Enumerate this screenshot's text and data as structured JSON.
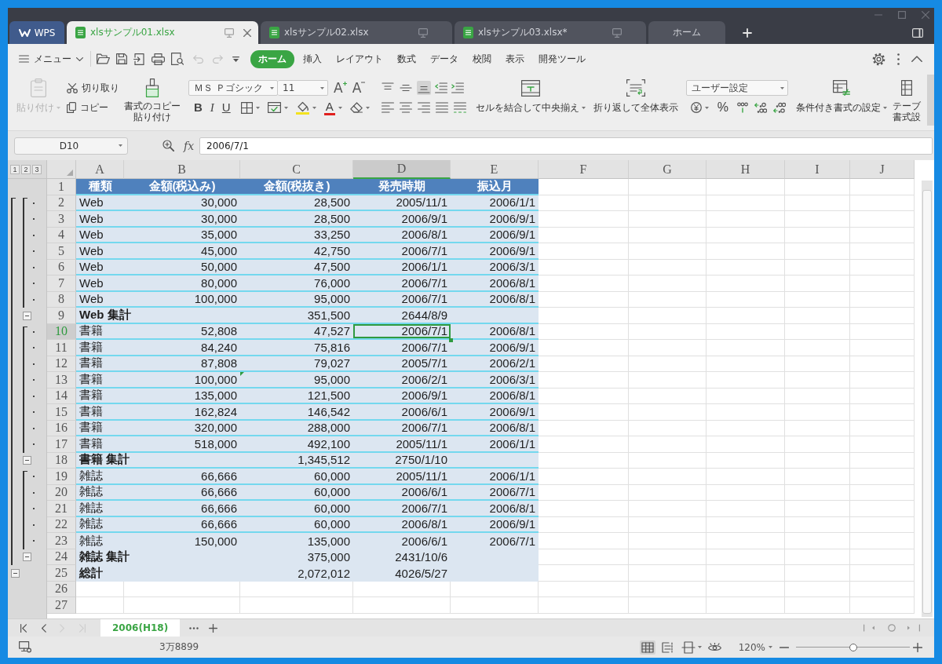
{
  "window": {
    "app_tab": {
      "label": "WPS"
    },
    "tabs": [
      {
        "kind": "file",
        "label": "xlsサンプル01.xlsx",
        "selected": true
      },
      {
        "kind": "file",
        "label": "xlsサンプル02.xlsx",
        "selected": false
      },
      {
        "kind": "file",
        "label": "xlsサンプル03.xlsx*",
        "selected": false
      },
      {
        "kind": "home",
        "label": "ホーム",
        "selected": false
      }
    ]
  },
  "menu_bar": {
    "menu": "メニュー",
    "undo": {
      "disabled": true
    },
    "redo": {
      "disabled": true
    },
    "tabs": [
      {
        "label": "ホーム",
        "selected": true
      },
      {
        "label": "挿入",
        "selected": false
      },
      {
        "label": "レイアウト",
        "selected": false
      },
      {
        "label": "数式",
        "selected": false
      },
      {
        "label": "データ",
        "selected": false
      },
      {
        "label": "校閲",
        "selected": false
      },
      {
        "label": "表示",
        "selected": false
      },
      {
        "label": "開発ツール",
        "selected": false
      }
    ]
  },
  "ribbon": {
    "paste": {
      "label": "貼り付け",
      "disabled": true
    },
    "cut": "切り取り",
    "copy": "コピー",
    "format_painter": [
      "書式のコピー",
      "貼り付け"
    ],
    "font_name": "ＭＳ Ｐゴシック",
    "font_size": "11",
    "grow_font": "A",
    "shrink_font": "A",
    "bold": "B",
    "italic": "I",
    "underline": "U",
    "font_color": "A",
    "vertical_align": [
      {
        "selected": false
      },
      {
        "selected": false
      },
      {
        "selected": true
      }
    ],
    "merge": "セルを結合して中央揃え",
    "wrap": "折り返して全体表示",
    "number_format": "ユーザー設定",
    "percent": "%",
    "conditional_format": "条件付き書式の設定",
    "table_format": [
      "テーブ",
      "書式設"
    ]
  },
  "formula_bar": {
    "cell": "D10",
    "fx": "fx",
    "value": "2006/7/1"
  },
  "sheet": {
    "outline_levels": [
      "1",
      "2",
      "3"
    ],
    "columns": [
      {
        "label": "A",
        "selected": false
      },
      {
        "label": "B",
        "selected": false
      },
      {
        "label": "C",
        "selected": false
      },
      {
        "label": "D",
        "selected": true
      },
      {
        "label": "E",
        "selected": false
      },
      {
        "label": "F",
        "selected": false
      },
      {
        "label": "G",
        "selected": false
      },
      {
        "label": "H",
        "selected": false
      },
      {
        "label": "I",
        "selected": false
      },
      {
        "label": "J",
        "selected": false
      }
    ],
    "rows": [
      {
        "kind": "header",
        "row": "1",
        "selected": false,
        "ruled": true,
        "cells": [
          "種類",
          "金額(税込み)",
          "金額(税抜き)",
          "発売時期",
          "振込月"
        ]
      },
      {
        "kind": "detail",
        "row": "2",
        "selected": false,
        "ruled": true,
        "flag": false,
        "cells": [
          "Web",
          "30,000",
          "28,500",
          "2005/11/1",
          "2006/1/1"
        ]
      },
      {
        "kind": "detail",
        "row": "3",
        "selected": false,
        "ruled": true,
        "flag": false,
        "cells": [
          "Web",
          "30,000",
          "28,500",
          "2006/9/1",
          "2006/9/1"
        ]
      },
      {
        "kind": "detail",
        "row": "4",
        "selected": false,
        "ruled": true,
        "flag": false,
        "cells": [
          "Web",
          "35,000",
          "33,250",
          "2006/8/1",
          "2006/9/1"
        ]
      },
      {
        "kind": "detail",
        "row": "5",
        "selected": false,
        "ruled": true,
        "flag": false,
        "cells": [
          "Web",
          "45,000",
          "42,750",
          "2006/7/1",
          "2006/9/1"
        ]
      },
      {
        "kind": "detail",
        "row": "6",
        "selected": false,
        "ruled": true,
        "flag": false,
        "cells": [
          "Web",
          "50,000",
          "47,500",
          "2006/1/1",
          "2006/3/1"
        ]
      },
      {
        "kind": "detail",
        "row": "7",
        "selected": false,
        "ruled": true,
        "flag": false,
        "cells": [
          "Web",
          "80,000",
          "76,000",
          "2006/7/1",
          "2006/8/1"
        ]
      },
      {
        "kind": "detail",
        "row": "8",
        "selected": false,
        "ruled": true,
        "flag": false,
        "cells": [
          "Web",
          "100,000",
          "95,000",
          "2006/7/1",
          "2006/8/1"
        ]
      },
      {
        "kind": "subtotal",
        "row": "9",
        "selected": false,
        "ruled": true,
        "expanded": true,
        "label": "Web 集計",
        "amount": "351,500",
        "date": "2644/8/9"
      },
      {
        "kind": "detail",
        "row": "10",
        "selected": true,
        "ruled": true,
        "flag": false,
        "cells": [
          "書籍",
          "52,808",
          "47,527",
          "2006/7/1",
          "2006/8/1"
        ]
      },
      {
        "kind": "detail",
        "row": "11",
        "selected": false,
        "ruled": true,
        "flag": false,
        "cells": [
          "書籍",
          "84,240",
          "75,816",
          "2006/7/1",
          "2006/9/1"
        ]
      },
      {
        "kind": "detail",
        "row": "12",
        "selected": false,
        "ruled": true,
        "flag": false,
        "cells": [
          "書籍",
          "87,808",
          "79,027",
          "2005/7/1",
          "2006/2/1"
        ]
      },
      {
        "kind": "detail",
        "row": "13",
        "selected": false,
        "ruled": true,
        "flag": true,
        "cells": [
          "書籍",
          "100,000",
          "95,000",
          "2006/2/1",
          "2006/3/1"
        ]
      },
      {
        "kind": "detail",
        "row": "14",
        "selected": false,
        "ruled": true,
        "flag": false,
        "cells": [
          "書籍",
          "135,000",
          "121,500",
          "2006/9/1",
          "2006/8/1"
        ]
      },
      {
        "kind": "detail",
        "row": "15",
        "selected": false,
        "ruled": true,
        "flag": false,
        "cells": [
          "書籍",
          "162,824",
          "146,542",
          "2006/6/1",
          "2006/9/1"
        ]
      },
      {
        "kind": "detail",
        "row": "16",
        "selected": false,
        "ruled": true,
        "flag": false,
        "cells": [
          "書籍",
          "320,000",
          "288,000",
          "2006/7/1",
          "2006/8/1"
        ]
      },
      {
        "kind": "detail",
        "row": "17",
        "selected": false,
        "ruled": true,
        "flag": false,
        "cells": [
          "書籍",
          "518,000",
          "492,100",
          "2005/11/1",
          "2006/1/1"
        ]
      },
      {
        "kind": "subtotal",
        "row": "18",
        "selected": false,
        "ruled": true,
        "expanded": true,
        "label": "書籍 集計",
        "amount": "1,345,512",
        "date": "2750/1/10"
      },
      {
        "kind": "detail",
        "row": "19",
        "selected": false,
        "ruled": true,
        "flag": false,
        "cells": [
          "雑誌",
          "66,666",
          "60,000",
          "2005/11/1",
          "2006/1/1"
        ]
      },
      {
        "kind": "detail",
        "row": "20",
        "selected": false,
        "ruled": true,
        "flag": false,
        "cells": [
          "雑誌",
          "66,666",
          "60,000",
          "2006/6/1",
          "2006/7/1"
        ]
      },
      {
        "kind": "detail",
        "row": "21",
        "selected": false,
        "ruled": true,
        "flag": false,
        "cells": [
          "雑誌",
          "66,666",
          "60,000",
          "2006/7/1",
          "2006/8/1"
        ]
      },
      {
        "kind": "detail",
        "row": "22",
        "selected": false,
        "ruled": true,
        "flag": false,
        "cells": [
          "雑誌",
          "66,666",
          "60,000",
          "2006/8/1",
          "2006/9/1"
        ]
      },
      {
        "kind": "detail",
        "row": "23",
        "selected": false,
        "ruled": false,
        "flag": false,
        "cells": [
          "雑誌",
          "150,000",
          "135,000",
          "2006/6/1",
          "2006/7/1"
        ]
      },
      {
        "kind": "subtotal",
        "row": "24",
        "selected": false,
        "ruled": false,
        "expanded": true,
        "label": "雑誌 集計",
        "amount": "375,000",
        "date": "2431/10/6"
      },
      {
        "kind": "total",
        "row": "25",
        "selected": false,
        "ruled": false,
        "expanded": true,
        "label": "総計",
        "amount": "2,072,012",
        "date": "4026/5/27"
      },
      {
        "kind": "empty",
        "row": "26",
        "selected": false
      },
      {
        "kind": "empty",
        "row": "27",
        "selected": false
      }
    ]
  },
  "sheet_tabs": {
    "navigation": [
      {
        "disabled": false
      },
      {
        "disabled": false
      },
      {
        "disabled": true
      },
      {
        "disabled": true
      }
    ],
    "tabs": [
      {
        "label": "2006(H18)",
        "selected": true
      }
    ]
  },
  "status_bar": {
    "summary": "3万8899",
    "views": [
      {
        "selected": true
      },
      {
        "selected": false
      },
      {
        "selected": false
      }
    ],
    "zoom": "120%",
    "zoom_slider": {
      "level": 0.5
    }
  }
}
